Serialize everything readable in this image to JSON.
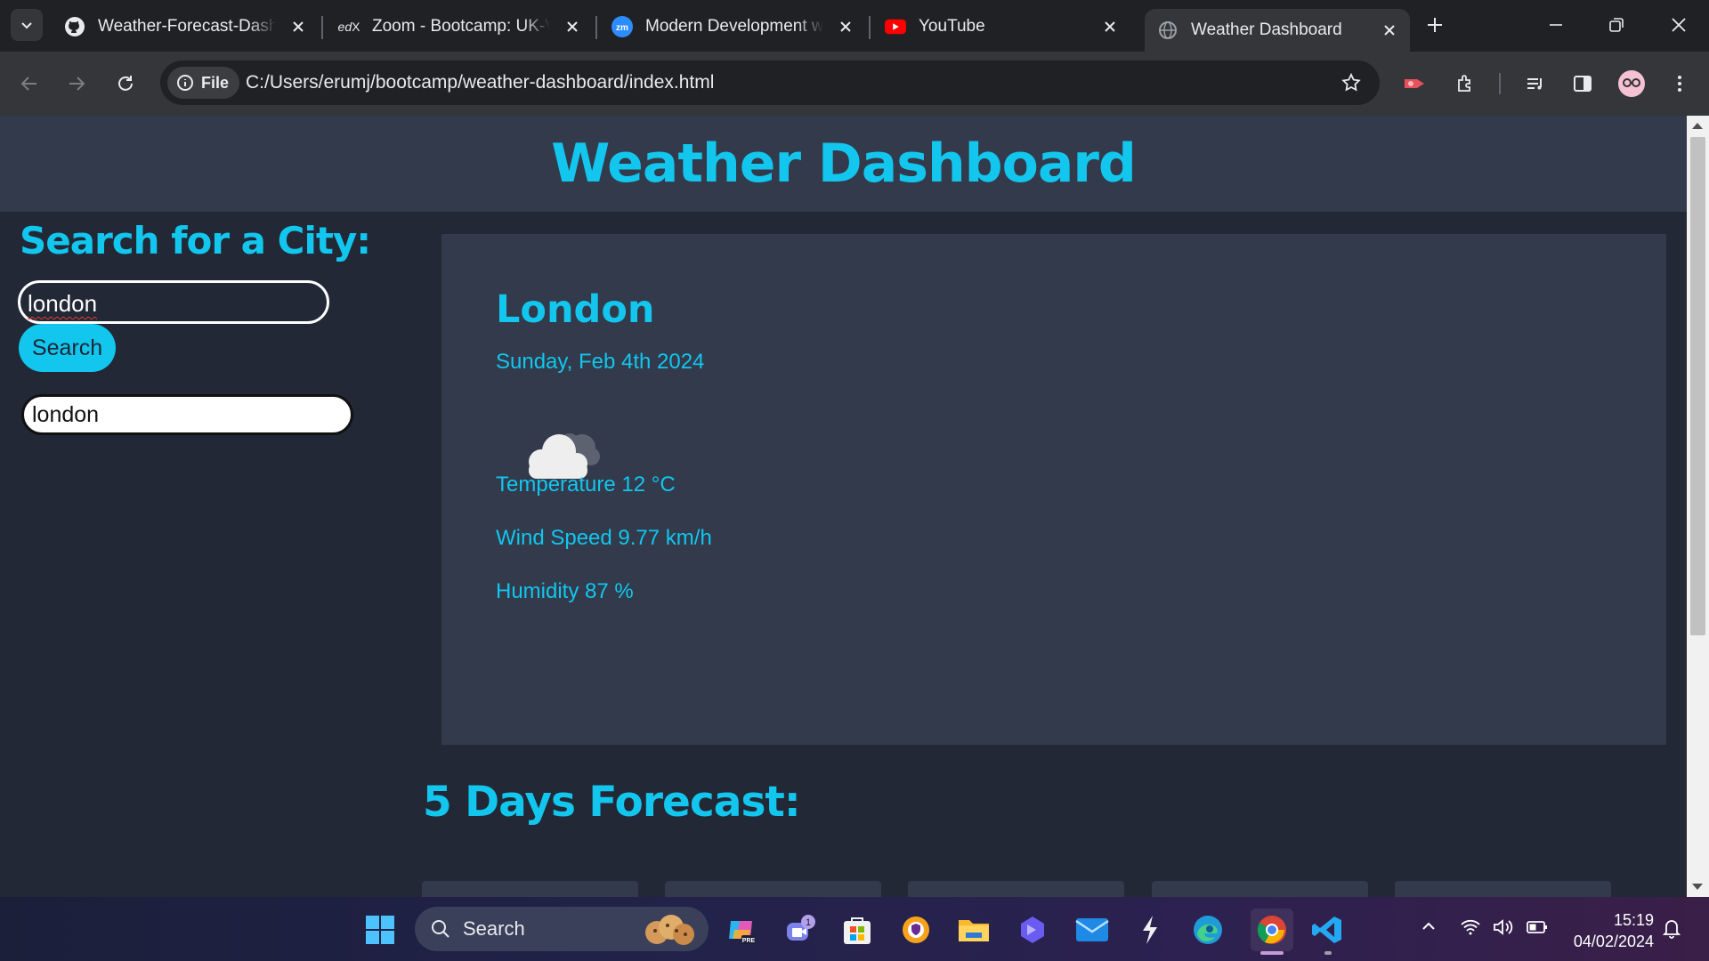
{
  "browser": {
    "tabs": [
      {
        "title": "Weather-Forecast-Dashb",
        "icon": "github-icon"
      },
      {
        "title": "Zoom - Bootcamp: UK-VI",
        "icon": "edx-icon"
      },
      {
        "title": "Modern Development wi",
        "icon": "zoom-icon"
      },
      {
        "title": "YouTube",
        "icon": "youtube-icon"
      },
      {
        "title": "Weather Dashboard",
        "icon": "globe-icon"
      }
    ],
    "active_tab": "Weather Dashboard",
    "site_chip": "File",
    "url": "C:/Users/erumj/bootcamp/weather-dashboard/index.html"
  },
  "page": {
    "title": "Weather Dashboard",
    "search_heading": "Search for a City:",
    "search_value": "london",
    "search_button": "Search",
    "history": [
      "london"
    ],
    "current": {
      "city": "London",
      "date": "Sunday, Feb 4th 2024",
      "icon": "cloud-icon",
      "temperature": "Temperature 12 °C",
      "wind": "Wind Speed 9.77 km/h",
      "humidity": "Humidity 87 %"
    },
    "forecast_heading": "5 Days Forecast:",
    "forecast_card_count": 5
  },
  "taskbar": {
    "search_label": "Search",
    "chat_badge": "1",
    "time": "15:19",
    "date": "04/02/2024"
  },
  "colors": {
    "accent": "#12c6ee",
    "header_bg": "#323a4b",
    "page_bg": "#222836"
  }
}
